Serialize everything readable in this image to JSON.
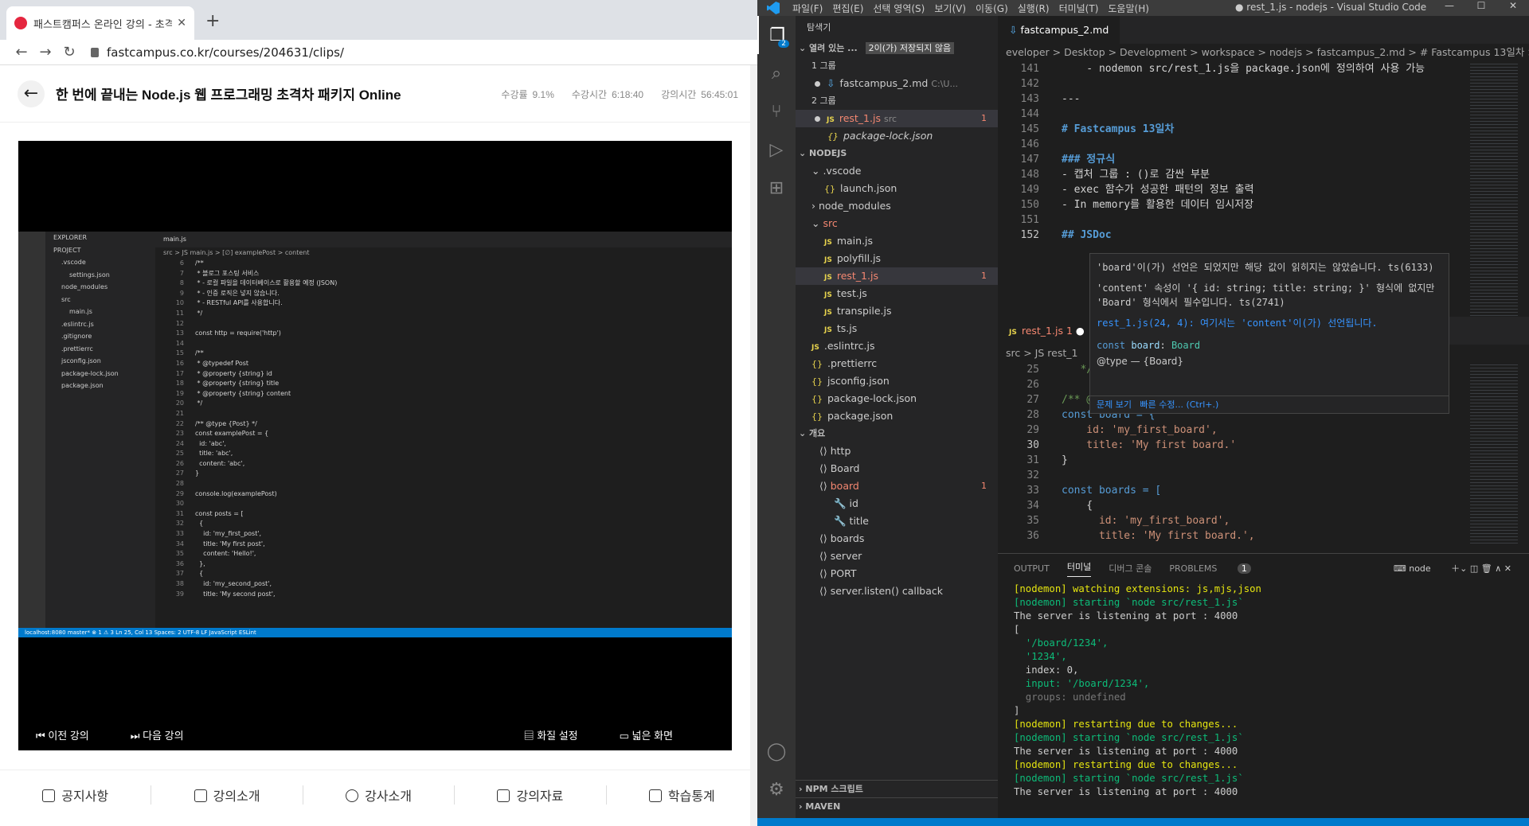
{
  "browser": {
    "tab_title": "패스트캠퍼스 온라인 강의 - 초격",
    "url": "fastcampus.co.kr/courses/204631/clips/",
    "course_title": "한 번에 끝내는 Node.js 웹 프로그래밍 초격차 패키지 Online",
    "stats": {
      "progress_label": "수강률",
      "progress_value": "9.1%",
      "watched_label": "수강시간",
      "watched_value": "6:18:40",
      "total_label": "강의시간",
      "total_value": "56:45:01"
    },
    "video": {
      "sidebar_items": [
        "EXPLORER",
        "PROJECT",
        ".vscode",
        "settings.json",
        "node_modules",
        "src",
        "main.js",
        ".eslintrc.js",
        ".gitignore",
        ".prettierrc",
        "jsconfig.json",
        "package-lock.json",
        "package.json"
      ],
      "tab": "main.js",
      "breadcrumb": "src > JS main.js > [∅] examplePost > content",
      "status": "localhost:8080   master*   ⊗ 1 ⚠ 3      Ln 25, Col 13   Spaces: 2   UTF-8   LF   JavaScript   ESLint",
      "code_lines": [
        [
          "6",
          "/**"
        ],
        [
          "7",
          " * 블로그 포스팅 서비스"
        ],
        [
          "8",
          " * - 로컬 파일을 데이터베이스로 활용할 예정 (JSON)"
        ],
        [
          "9",
          " * - 인증 로직은 넣지 않습니다."
        ],
        [
          "10",
          " * - RESTful API를 사용합니다."
        ],
        [
          "11",
          " */"
        ],
        [
          "12",
          ""
        ],
        [
          "13",
          "const http = require('http')"
        ],
        [
          "14",
          ""
        ],
        [
          "15",
          "/**"
        ],
        [
          "16",
          " * @typedef Post"
        ],
        [
          "17",
          " * @property {string} id"
        ],
        [
          "18",
          " * @property {string} title"
        ],
        [
          "19",
          " * @property {string} content"
        ],
        [
          "20",
          " */"
        ],
        [
          "21",
          ""
        ],
        [
          "22",
          "/** @type {Post} */"
        ],
        [
          "23",
          "const examplePost = {"
        ],
        [
          "24",
          "  id: 'abc',"
        ],
        [
          "25",
          "  title: 'abc',"
        ],
        [
          "26",
          "  content: 'abc',"
        ],
        [
          "27",
          "}"
        ],
        [
          "28",
          ""
        ],
        [
          "29",
          "console.log(examplePost)"
        ],
        [
          "30",
          ""
        ],
        [
          "31",
          "const posts = ["
        ],
        [
          "32",
          "  {"
        ],
        [
          "33",
          "    id: 'my_first_post',"
        ],
        [
          "34",
          "    title: 'My first post',"
        ],
        [
          "35",
          "    content: 'Hello!',"
        ],
        [
          "36",
          "  },"
        ],
        [
          "37",
          "  {"
        ],
        [
          "38",
          "    id: 'my_second_post',"
        ],
        [
          "39",
          "    title: 'My second post',"
        ]
      ]
    },
    "controls": {
      "prev": "이전 강의",
      "next": "다음 강의",
      "quality": "화질 설정",
      "wide": "넓은 화면"
    },
    "bottom_nav": [
      "공지사항",
      "강의소개",
      "강사소개",
      "강의자료",
      "학습통계"
    ]
  },
  "vscode": {
    "menu": [
      "파일(F)",
      "편집(E)",
      "선택 영역(S)",
      "보기(V)",
      "이동(G)",
      "실행(R)",
      "터미널(T)",
      "도움말(H)"
    ],
    "window_title": "● rest_1.js - nodejs - Visual Studio Code",
    "sidebar": {
      "title": "탐색기",
      "open_editors": "열려 있는 ...",
      "unsaved": "2이(가) 저장되지 않음",
      "group1": "1 그룹",
      "group1_file": "fastcampus_2.md",
      "group1_path": "C:\\U...",
      "group2": "2 그룹",
      "group2_file1": "rest_1.js",
      "group2_file1_dir": "src",
      "group2_file2": "package-lock.json",
      "project": "NODEJS",
      "tree": [
        ".vscode",
        "launch.json",
        "node_modules",
        "src",
        "main.js",
        "polyfill.js",
        "rest_1.js",
        "test.js",
        "transpile.js",
        "ts.js",
        ".eslintrc.js",
        ".prettierrc",
        "jsconfig.json",
        "package-lock.json",
        "package.json"
      ],
      "outline_title": "개요",
      "outline": [
        "http",
        "Board",
        "board",
        "id",
        "title",
        "boards",
        "server",
        "PORT",
        "server.listen() callback"
      ],
      "npm": "NPM 스크립트",
      "maven": "MAVEN",
      "error_count": "1"
    },
    "editor1": {
      "tab": "fastcampus_2.md",
      "breadcrumb": "eveloper > Desktop > Development > workspace > nodejs > fastcampus_2.md > # Fastcampus 13일차 > ## JSDoc",
      "lines": [
        [
          "141",
          "    - nodemon src/rest_1.js을 package.json에 정의하여 사용 가능"
        ],
        [
          "142",
          ""
        ],
        [
          "143",
          "---"
        ],
        [
          "144",
          ""
        ],
        [
          "145",
          "# Fastcampus 13일차"
        ],
        [
          "146",
          ""
        ],
        [
          "147",
          "### 정규식"
        ],
        [
          "148",
          "- 캡처 그룹 : ()로 감싼 부분"
        ],
        [
          "149",
          "- exec 함수가 성공한 패턴의 정보 출력"
        ],
        [
          "150",
          "- In memory를 활용한 데이터 임시저장"
        ],
        [
          "151",
          ""
        ],
        [
          "152",
          "## JSDoc"
        ]
      ]
    },
    "editor2": {
      "tab": "rest_1.js",
      "tab_errors": "1",
      "breadcrumb": "src > JS rest_1",
      "lines": [
        [
          "25",
          "   */"
        ],
        [
          "26",
          ""
        ],
        [
          "27",
          "/** @t"
        ],
        [
          "28",
          "const board = {"
        ],
        [
          "29",
          "    id: 'my_first_board',"
        ],
        [
          "30",
          "    title: 'My first board.'"
        ],
        [
          "31",
          "}"
        ],
        [
          "32",
          ""
        ],
        [
          "33",
          "const boards = ["
        ],
        [
          "34",
          "    {"
        ],
        [
          "35",
          "      id: 'my_first_board',"
        ],
        [
          "36",
          "      title: 'My first board.',"
        ]
      ]
    },
    "hover": {
      "msg1": "'board'이(가) 선언은 되었지만 해당 값이 읽히지는 않았습니다. ts(6133)",
      "msg2": "'content' 속성이 '{ id: string; title: string; }' 형식에 없지만 'Board' 형식에서 필수입니다. ts(2741)",
      "msg3": "rest_1.js(24, 4): 여기서는 'content'이(가) 선언됩니다.",
      "code": "const board: Board",
      "type": "@type — {Board}",
      "foot1": "문제 보기",
      "foot2": "빠른 수정... (Ctrl+.)"
    },
    "panel": {
      "tabs": [
        "OUTPUT",
        "터미널",
        "디버그 콘솔",
        "PROBLEMS"
      ],
      "problems_count": "1",
      "shell": "node",
      "terminal": [
        "[nodemon] watching extensions: js,mjs,json",
        "[nodemon] starting `node src/rest_1.js`",
        "The server is listening at port : 4000",
        "[",
        "  '/board/1234',",
        "  '1234',",
        "  index: 0,",
        "  input: '/board/1234',",
        "  groups: undefined",
        "]",
        "[nodemon] restarting due to changes...",
        "[nodemon] starting `node src/rest_1.js`",
        "The server is listening at port : 4000",
        "[nodemon] restarting due to changes...",
        "[nodemon] starting `node src/rest_1.js`",
        "The server is listening at port : 4000"
      ]
    }
  }
}
